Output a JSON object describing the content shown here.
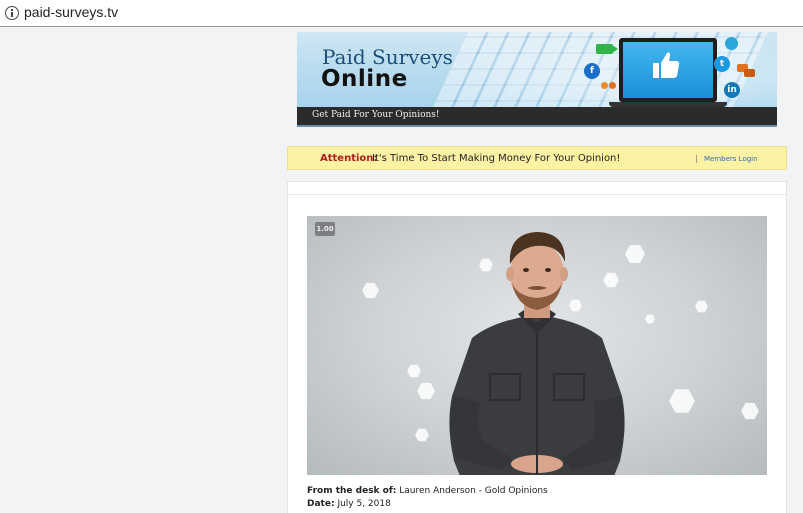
{
  "browser": {
    "url": "paid-surveys.tv"
  },
  "banner": {
    "title_line1": "Paid Surveys",
    "title_line2": "Online",
    "tagline": "Get Paid For Your Opinions!",
    "social_labels": {
      "facebook": "f",
      "twitter": "t",
      "linkedin": "in"
    }
  },
  "attention": {
    "label": "Attention:",
    "text": "It's Time To Start Making Money For Your Opinion!",
    "separator": "|",
    "members_login": "Members Login"
  },
  "video": {
    "speed": "1.00"
  },
  "meta": {
    "desk_label": "From the desk of:",
    "desk_value": "Lauren Anderson - Gold Opinions",
    "date_label": "Date:",
    "date_value": "July 5, 2018"
  },
  "colors": {
    "attention_bg": "#fcf2a4",
    "attention_label": "#b01d1d",
    "login_link": "#2f6fa8",
    "banner_strip": "#2b2b2b"
  }
}
